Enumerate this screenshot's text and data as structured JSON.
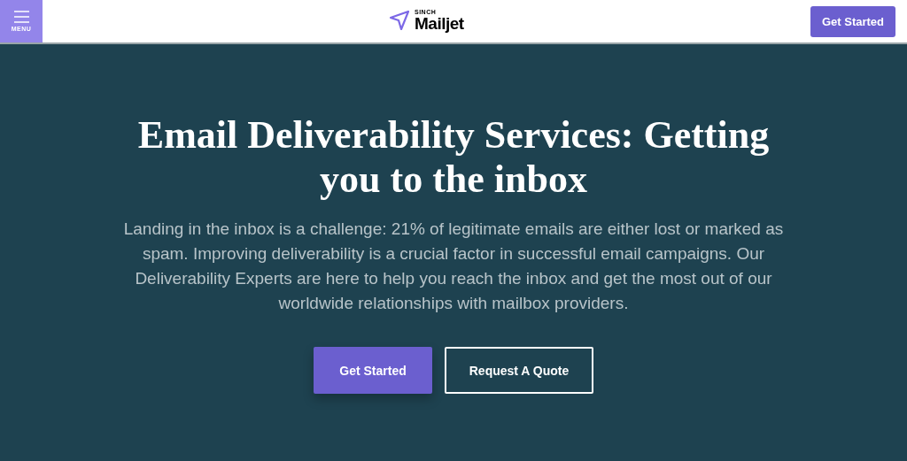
{
  "header": {
    "menu_label": "MENU",
    "logo_small": "SINCH",
    "logo_main": "Mailjet",
    "cta": "Get Started"
  },
  "hero": {
    "title": "Email Deliverability Services: Getting you to the inbox",
    "text": "Landing in the inbox is a challenge: 21% of legitimate emails are either lost or marked as spam. Improving deliverability is a crucial factor in successful email campaigns. Our Deliverability Experts are here to help you reach the inbox and get the most out of our worldwide relationships with mailbox providers.",
    "buttons": [
      {
        "label": "Get Started",
        "kind": "primary"
      },
      {
        "label": "Request A Quote",
        "kind": "outline"
      }
    ]
  }
}
